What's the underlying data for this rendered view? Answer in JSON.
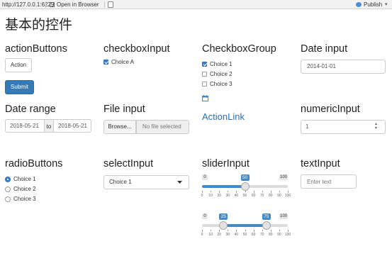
{
  "browser": {
    "url": "http://127.0.0.1:6229",
    "open_in_browser": "Open in Browser",
    "publish": "Publish"
  },
  "page": {
    "title": "基本的控件"
  },
  "action_buttons": {
    "heading": "actionButtons",
    "action_label": "Action",
    "submit_label": "Submit"
  },
  "checkbox_input": {
    "heading": "checkboxInput",
    "label": "Choice A",
    "checked": true
  },
  "checkbox_group": {
    "heading": "CheckboxGroup",
    "choices": [
      {
        "label": "Choice 1",
        "checked": true
      },
      {
        "label": "Choice 2",
        "checked": false
      },
      {
        "label": "Choice 3",
        "checked": false
      }
    ],
    "icon": "calendar-icon"
  },
  "date_input": {
    "heading": "Date input",
    "value": "2014-01-01"
  },
  "date_range": {
    "heading": "Date range",
    "start": "2018-05-21",
    "separator": "to",
    "end": "2018-05-21"
  },
  "file_input": {
    "heading": "File input",
    "browse_label": "Browse...",
    "placeholder": "No file selected"
  },
  "action_link": {
    "label": "ActionLink"
  },
  "numeric_input": {
    "heading": "numericInput",
    "value": "1"
  },
  "radio_buttons": {
    "heading": "radioButtons",
    "choices": [
      {
        "label": "Choice 1",
        "selected": true
      },
      {
        "label": "Choice 2",
        "selected": false
      },
      {
        "label": "Choice 3",
        "selected": false
      }
    ]
  },
  "select_input": {
    "heading": "selectInput",
    "selected": "Choice 1"
  },
  "slider_input": {
    "heading": "sliderInput",
    "min": 0,
    "max": 100,
    "single": {
      "value": 50
    },
    "range": {
      "from": 25,
      "to": 75
    },
    "ticks": [
      "0",
      "10",
      "20",
      "30",
      "40",
      "50",
      "60",
      "70",
      "80",
      "90",
      "100"
    ]
  },
  "text_input": {
    "heading": "textInput",
    "placeholder": "Enter text"
  },
  "colors": {
    "primary": "#337ab7",
    "link": "#2d6fb4",
    "slider": "#428bca"
  }
}
